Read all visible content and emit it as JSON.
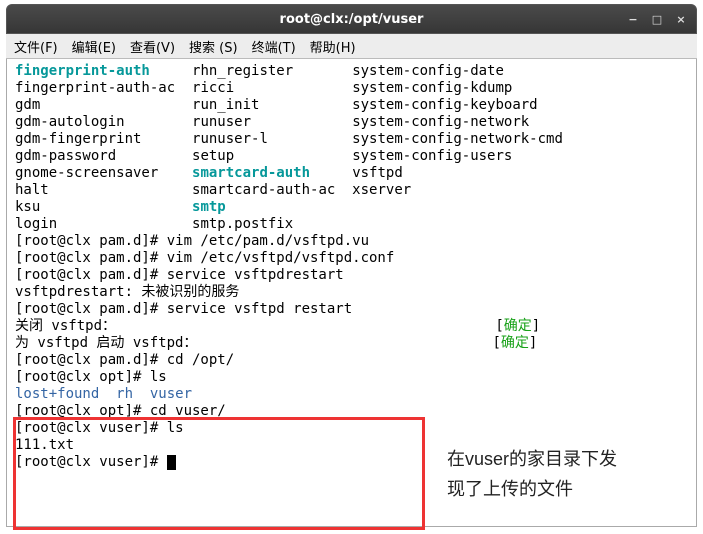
{
  "window": {
    "title": "root@clx:/opt/vuser",
    "controls": {
      "min": "−",
      "max": "□",
      "close": "×"
    }
  },
  "menu": {
    "file": "文件(F)",
    "edit": "编辑(E)",
    "view": "查看(V)",
    "search": "搜索 (S)",
    "terminal": "终端(T)",
    "help": "帮助(H)"
  },
  "listing": {
    "c1r1": "fingerprint-auth",
    "c1r2": "fingerprint-auth-ac",
    "c1r3": "gdm",
    "c1r4": "gdm-autologin",
    "c1r5": "gdm-fingerprint",
    "c1r6": "gdm-password",
    "c1r7": "gnome-screensaver",
    "c1r8": "halt",
    "c1r9": "ksu",
    "c1r10": "login",
    "c2r1": "rhn_register",
    "c2r2": "ricci",
    "c2r3": "run_init",
    "c2r4": "runuser",
    "c2r5": "runuser-l",
    "c2r6": "setup",
    "c2r7": "smartcard-auth",
    "c2r8": "smartcard-auth-ac",
    "c2r9": "smtp",
    "c2r10": "smtp.postfix",
    "c3r1": "system-config-date",
    "c3r2": "system-config-kdump",
    "c3r3": "system-config-keyboard",
    "c3r4": "system-config-network",
    "c3r5": "system-config-network-cmd",
    "c3r6": "system-config-users",
    "c3r7": "vsftpd",
    "c3r8": "xserver"
  },
  "cmds": {
    "l1": "[root@clx pam.d]# vim /etc/pam.d/vsftpd.vu",
    "l2": "[root@clx pam.d]# vim /etc/vsftpd/vsftpd.conf",
    "l3": "[root@clx pam.d]# service vsftpdrestart",
    "l4": "vsftpdrestart: 未被识别的服务",
    "l5": "[root@clx pam.d]# service vsftpd restart",
    "l6a": "关闭 vsftpd：",
    "l7a": "为 vsftpd 启动 vsftpd：",
    "ok_left": "[",
    "ok_text": "确定",
    "ok_right": "]",
    "l8": "[root@clx pam.d]# cd /opt/",
    "l9": "[root@clx opt]# ls",
    "l10a": "lost+found",
    "l10b": "rh",
    "l10c": "vuser",
    "l11": "[root@clx opt]# cd vuser/",
    "l12": "[root@clx vuser]# ls",
    "l13": "111.txt",
    "l14": "[root@clx vuser]# "
  },
  "annotation": {
    "line1": "在vuser的家目录下发",
    "line2": "现了上传的文件"
  }
}
